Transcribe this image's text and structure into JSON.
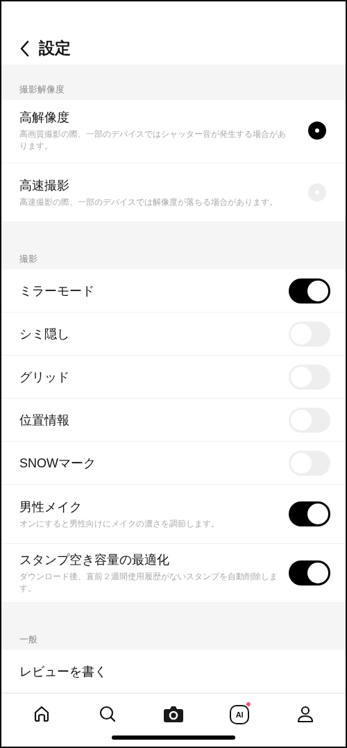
{
  "header": {
    "title": "設定"
  },
  "sections": [
    {
      "title": "撮影解像度",
      "items": [
        {
          "kind": "radio",
          "label": "高解像度",
          "description": "高画質撮影の際、一部のデバイスではシャッター音が発生する場合があります。",
          "selected": true
        },
        {
          "kind": "radio",
          "label": "高速撮影",
          "description": "高速撮影の際、一部のデバイスでは解像度が落ちる場合があります。",
          "selected": false
        }
      ]
    },
    {
      "title": "撮影",
      "items": [
        {
          "kind": "toggle",
          "label": "ミラーモード",
          "on": true
        },
        {
          "kind": "toggle",
          "label": "シミ隠し",
          "on": false
        },
        {
          "kind": "toggle",
          "label": "グリッド",
          "on": false
        },
        {
          "kind": "toggle",
          "label": "位置情報",
          "on": false
        },
        {
          "kind": "toggle",
          "label": "SNOWマーク",
          "on": false
        },
        {
          "kind": "toggle",
          "label": "男性メイク",
          "description": "オンにすると男性向けにメイクの濃さを調節します。",
          "on": true
        },
        {
          "kind": "toggle",
          "label": "スタンプ空き容量の最適化",
          "description": "ダウンロード後、直前２週間使用履歴がないスタンプを自動削除します。",
          "on": true
        }
      ]
    },
    {
      "title": "一般",
      "items": [
        {
          "kind": "link",
          "label": "レビューを書く"
        }
      ]
    }
  ],
  "tab_bar": [
    {
      "kind": "home",
      "badge": false
    },
    {
      "kind": "search",
      "badge": false
    },
    {
      "kind": "camera",
      "badge": false
    },
    {
      "kind": "ai",
      "label": "AI",
      "badge": true
    },
    {
      "kind": "profile",
      "badge": false
    }
  ]
}
